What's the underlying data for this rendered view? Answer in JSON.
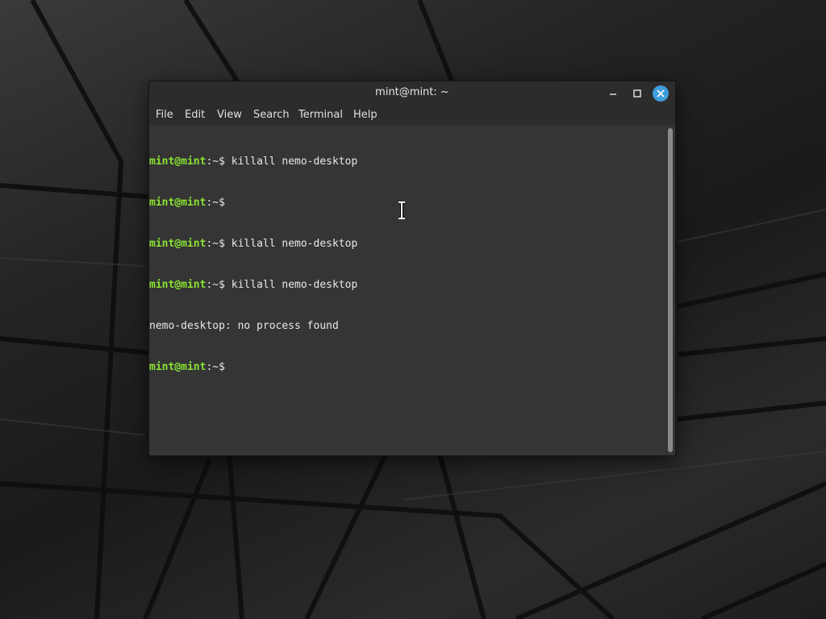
{
  "window": {
    "title": "mint@mint: ~",
    "controls": {
      "minimize_icon": "minimize-icon",
      "maximize_icon": "maximize-icon",
      "close_icon": "close-icon"
    }
  },
  "menubar": {
    "items": [
      "File",
      "Edit",
      "View",
      "Search",
      "Terminal",
      "Help"
    ]
  },
  "terminal": {
    "lines": [
      {
        "user": "mint@mint",
        "path": ":~$",
        "command": " killall nemo-desktop"
      },
      {
        "user": "mint@mint",
        "path": ":~$",
        "command": ""
      },
      {
        "user": "mint@mint",
        "path": ":~$",
        "command": " killall nemo-desktop"
      },
      {
        "user": "mint@mint",
        "path": ":~$",
        "command": " killall nemo-desktop"
      },
      {
        "output": "nemo-desktop: no process found"
      },
      {
        "user": "mint@mint",
        "path": ":~$",
        "command": ""
      }
    ]
  },
  "colors": {
    "prompt_user": "#8ae234",
    "close_button": "#3e9dda",
    "terminal_bg": "#353535",
    "titlebar_bg": "#2c2c2c"
  }
}
